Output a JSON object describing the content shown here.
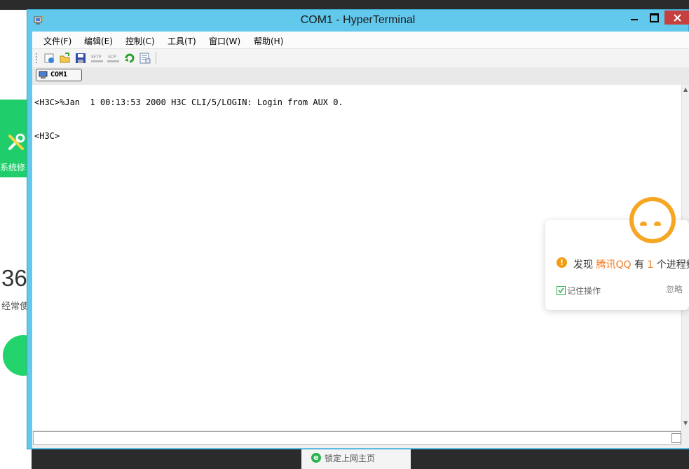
{
  "background_app": {
    "tile_label": "系统修",
    "big_number": "36",
    "small_text": "经常使",
    "bottom_bar_text": "锁定上网主页",
    "bottom_bar_icon": "e"
  },
  "window": {
    "title": "COM1 - HyperTerminal",
    "menu": [
      "文件(F)",
      "编辑(E)",
      "控制(C)",
      "工具(T)",
      "窗口(W)",
      "帮助(H)"
    ],
    "toolbar_icons": [
      "new-connection-icon",
      "open-icon",
      "save-icon",
      "sftp-icon",
      "scp-icon",
      "refresh-icon",
      "properties-icon"
    ],
    "toolbar_labels": {
      "sftp": "SFTP",
      "scp": "SCP"
    },
    "tab_label": "COM1"
  },
  "terminal": {
    "lines": [
      "<H3C>%Jan  1 00:13:53 2000 H3C CLI/5/LOGIN: Login from AUX 0.",
      "",
      "",
      "<H3C>"
    ]
  },
  "popup": {
    "prefix": "发现",
    "app": "腾讯QQ",
    "middle": "有",
    "count": "1",
    "suffix": "个进程频",
    "remember_label": "记住操作",
    "ignore_label": "忽略"
  },
  "colors": {
    "title_bar": "#62c8ec",
    "close_button": "#c74040",
    "highlight_orange": "#f37a1f",
    "green": "#1fce6b"
  }
}
